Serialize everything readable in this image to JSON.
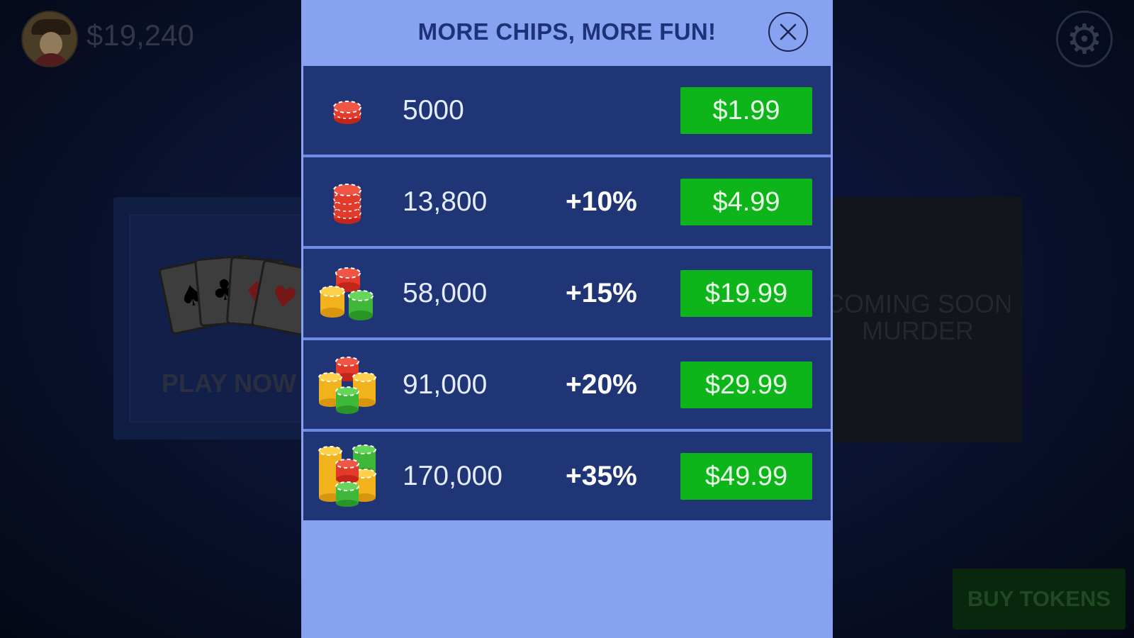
{
  "header": {
    "balance": "$19,240"
  },
  "background": {
    "play_now_label": "PLAY NOW",
    "coming_soon_line1": "COMING SOON",
    "coming_soon_line2": "MURDER",
    "buy_tokens_label": "BUY TOKENS"
  },
  "modal": {
    "title": "MORE CHIPS, MORE FUN!",
    "offers": [
      {
        "amount": "5000",
        "bonus": "",
        "price": "$1.99",
        "icon": "chip-stack-small-icon"
      },
      {
        "amount": "13,800",
        "bonus": "+10%",
        "price": "$4.99",
        "icon": "chip-stack-medium-icon"
      },
      {
        "amount": "58,000",
        "bonus": "+15%",
        "price": "$19.99",
        "icon": "chip-piles-three-icon"
      },
      {
        "amount": "91,000",
        "bonus": "+20%",
        "price": "$29.99",
        "icon": "chip-piles-four-icon"
      },
      {
        "amount": "170,000",
        "bonus": "+35%",
        "price": "$49.99",
        "icon": "chip-piles-five-icon"
      }
    ]
  },
  "colors": {
    "modal_bg": "#87a2f0",
    "row_bg": "#1f3576",
    "price_button": "#0eb51a",
    "title": "#1e3278"
  }
}
